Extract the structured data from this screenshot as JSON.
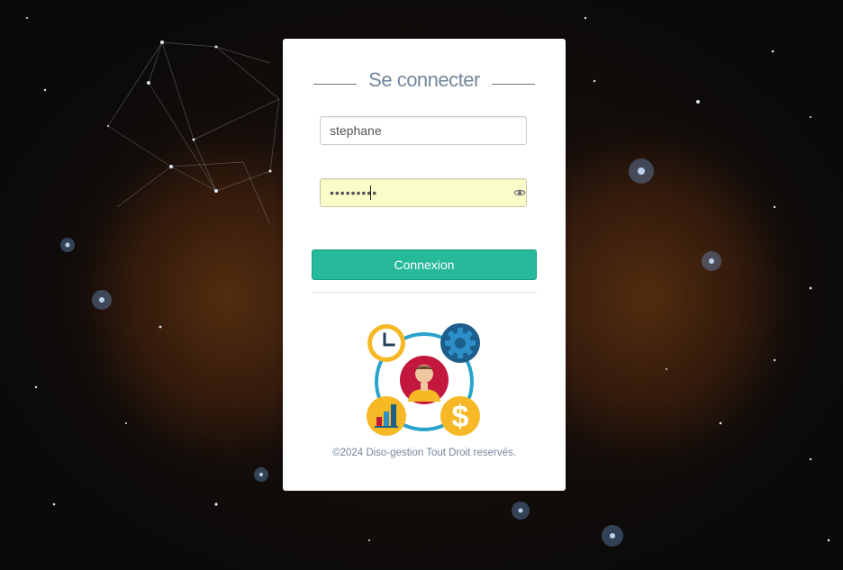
{
  "login": {
    "title": "Se connecter",
    "username_value": "stephane",
    "password_value": "•••••••••",
    "submit_label": "Connexion",
    "footer_text": "©2024 Diso-gestion Tout Droit reservés."
  },
  "colors": {
    "accent": "#26b99a",
    "title_text": "#73879c",
    "autofill_bg": "#fbfdc8"
  },
  "icons": {
    "password_toggle": "eye-icon",
    "logo": "business-management-logo"
  }
}
